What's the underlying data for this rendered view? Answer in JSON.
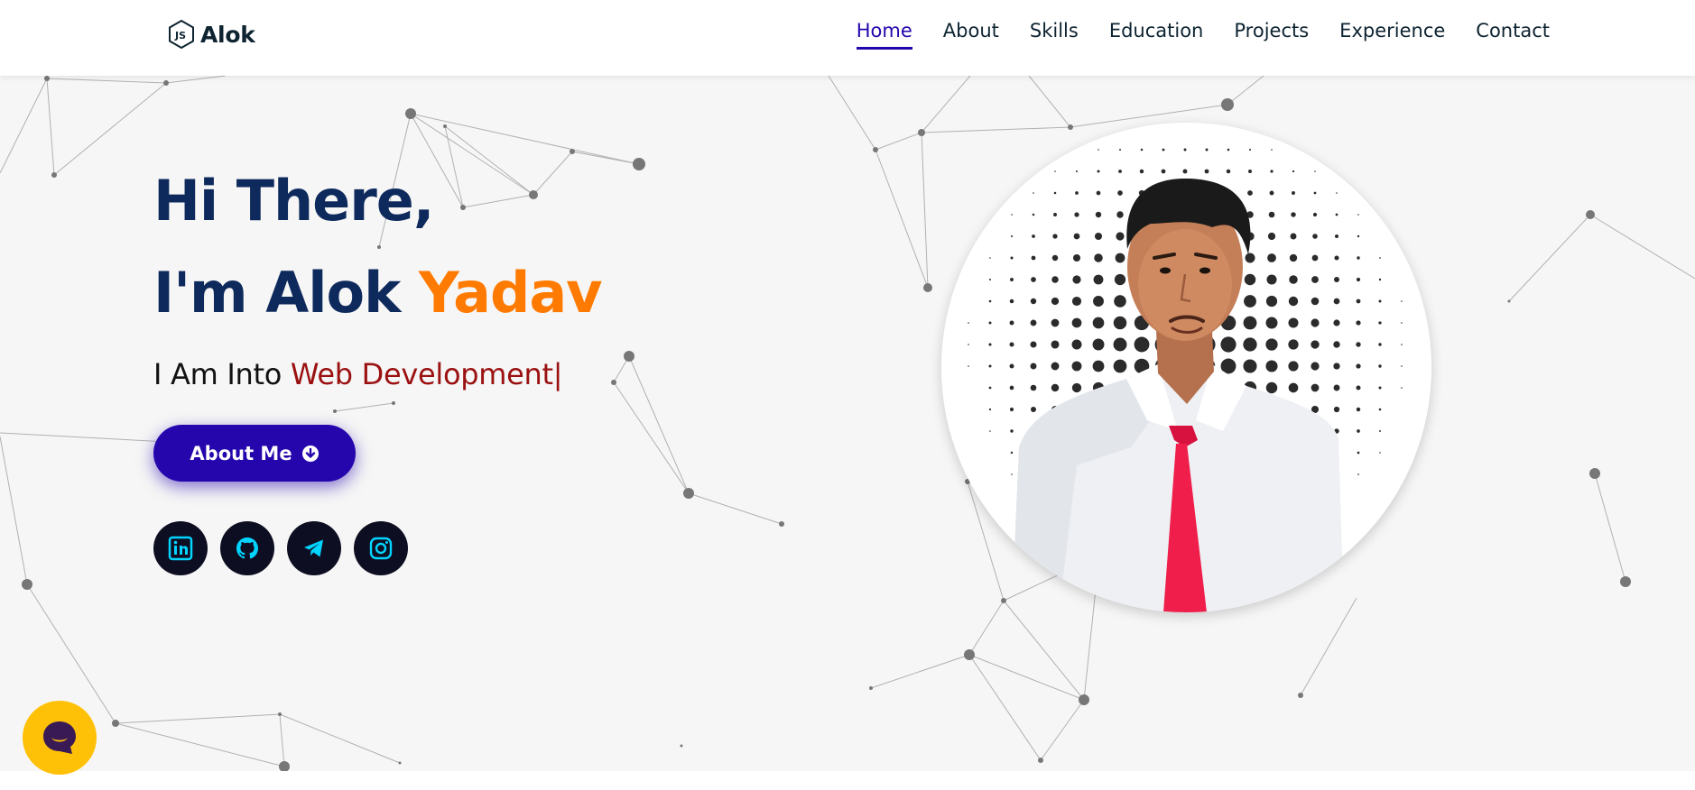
{
  "brand": {
    "name": "Alok",
    "icon": "nodejs-icon"
  },
  "nav": {
    "items": [
      {
        "label": "Home",
        "active": true
      },
      {
        "label": "About",
        "active": false
      },
      {
        "label": "Skills",
        "active": false
      },
      {
        "label": "Education",
        "active": false
      },
      {
        "label": "Projects",
        "active": false
      },
      {
        "label": "Experience",
        "active": false
      },
      {
        "label": "Contact",
        "active": false
      }
    ]
  },
  "hero": {
    "greeting": "Hi There,",
    "intro_prefix": "I'm Alok",
    "intro_highlight": "Yadav",
    "typed_prefix": "I Am Into",
    "typed_highlight": "Web Development",
    "typed_cursor": "|",
    "about_button": "About Me",
    "about_button_icon": "arrow-circle-down-icon",
    "socials": [
      {
        "name": "linkedin-icon"
      },
      {
        "name": "github-icon"
      },
      {
        "name": "telegram-icon"
      },
      {
        "name": "instagram-icon"
      }
    ],
    "profile_photo": "profile-photo"
  },
  "chat": {
    "icon": "chat-face-icon"
  },
  "colors": {
    "primary": "#2506ad",
    "heading": "#0e2a5c",
    "accent_orange": "#ff7a00",
    "typed_red": "#9b1111",
    "social_bg": "#0e0e22",
    "social_icon": "#00d4ff",
    "chat_bg": "#ffc107",
    "hero_bg": "#f6f6f6"
  }
}
